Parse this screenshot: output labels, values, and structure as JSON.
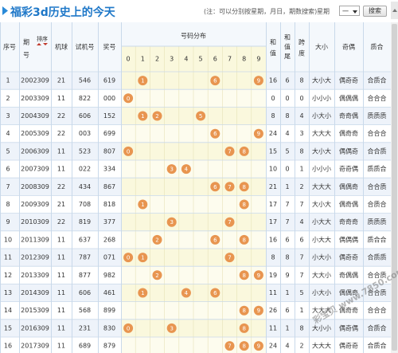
{
  "header": {
    "title": "福彩3d历史上的今天",
    "note": "(注：可以分别按星期，月日，期数搜索)",
    "week_label": "星期",
    "week_select": "一",
    "search_label": "搜索"
  },
  "columns": {
    "seq": "序号",
    "period": "期号",
    "sort": "排序",
    "machine": "机球",
    "test": "试机号",
    "prize": "奖号",
    "dist": "号码分布",
    "sum": "和值",
    "sumtail": "和值尾",
    "span": "跨度",
    "size": "大小",
    "oddeven": "奇偶",
    "prime": "质合",
    "digits": [
      "0",
      "1",
      "2",
      "3",
      "4",
      "5",
      "6",
      "7",
      "8",
      "9"
    ]
  },
  "colors": {
    "ball": "#e89550",
    "ball_text": "#ffffff",
    "odd_row": "#eef3fa",
    "even_row": "#ffffff",
    "dist_odd": "#faf8dd",
    "dist_even": "#fdfcee",
    "border": "#c9d9ea",
    "title": "#1f78c8"
  },
  "watermark": "彩宝贝 www.7850.com",
  "chart_data": {
    "type": "table",
    "rows": [
      {
        "seq": "1",
        "period": "2002309",
        "machine": "21",
        "test": "546",
        "prize": "619",
        "balls": [
          1,
          6,
          9
        ],
        "sum": "16",
        "tail": "6",
        "span": "8",
        "size": "大小大",
        "oe": "偶奇奇",
        "pc": "合质合"
      },
      {
        "seq": "2",
        "period": "2003309",
        "machine": "11",
        "test": "822",
        "prize": "000",
        "balls": [
          0
        ],
        "sum": "0",
        "tail": "0",
        "span": "0",
        "size": "小小小",
        "oe": "偶偶偶",
        "pc": "合合合"
      },
      {
        "seq": "3",
        "period": "2004309",
        "machine": "22",
        "test": "606",
        "prize": "152",
        "balls": [
          1,
          2,
          5
        ],
        "sum": "8",
        "tail": "8",
        "span": "4",
        "size": "小大小",
        "oe": "奇奇偶",
        "pc": "质质质"
      },
      {
        "seq": "4",
        "period": "2005309",
        "machine": "22",
        "test": "003",
        "prize": "699",
        "balls": [
          6,
          9
        ],
        "sum": "24",
        "tail": "4",
        "span": "3",
        "size": "大大大",
        "oe": "偶奇奇",
        "pc": "合合合"
      },
      {
        "seq": "5",
        "period": "2006309",
        "machine": "11",
        "test": "523",
        "prize": "807",
        "balls": [
          0,
          7,
          8
        ],
        "sum": "15",
        "sum_alt": "",
        "tail": "5",
        "span": "8",
        "size": "大小大",
        "oe": "偶偶奇",
        "pc": "合合质"
      },
      {
        "seq": "6",
        "period": "2007309",
        "machine": "11",
        "test": "022",
        "prize": "334",
        "balls": [
          3,
          4
        ],
        "sum": "10",
        "tail": "0",
        "span": "1",
        "size": "小小小",
        "oe": "奇奇偶",
        "pc": "质质合"
      },
      {
        "seq": "7",
        "period": "2008309",
        "machine": "22",
        "test": "434",
        "prize": "867",
        "balls": [
          6,
          7,
          8
        ],
        "sum": "21",
        "tail": "1",
        "span": "2",
        "size": "大大大",
        "oe": "偶偶奇",
        "pc": "合合质"
      },
      {
        "seq": "8",
        "period": "2009309",
        "machine": "21",
        "test": "708",
        "prize": "818",
        "balls": [
          1,
          8
        ],
        "sum": "17",
        "tail": "7",
        "span": "7",
        "size": "大小大",
        "oe": "偶奇偶",
        "pc": "合质合"
      },
      {
        "seq": "9",
        "period": "2010309",
        "machine": "22",
        "test": "819",
        "prize": "377",
        "balls": [
          3,
          7
        ],
        "sum": "17",
        "tail": "7",
        "span": "4",
        "size": "小大大",
        "oe": "奇奇奇",
        "pc": "质质质"
      },
      {
        "seq": "10",
        "period": "2011309",
        "machine": "11",
        "test": "637",
        "prize": "268",
        "balls": [
          2,
          6,
          8
        ],
        "sum": "16",
        "tail": "6",
        "span": "6",
        "size": "小大大",
        "oe": "偶偶偶",
        "pc": "质合合"
      },
      {
        "seq": "11",
        "period": "2012309",
        "machine": "11",
        "test": "787",
        "prize": "071",
        "balls": [
          0,
          1,
          7
        ],
        "sum": "8",
        "tail": "8",
        "span": "7",
        "size": "小大小",
        "oe": "偶奇奇",
        "pc": "合质质"
      },
      {
        "seq": "12",
        "period": "2013309",
        "machine": "11",
        "test": "877",
        "prize": "982",
        "balls": [
          2,
          8,
          9
        ],
        "sum": "19",
        "tail": "9",
        "span": "7",
        "size": "大大小",
        "oe": "奇偶偶",
        "pc": "合合质"
      },
      {
        "seq": "13",
        "period": "2014309",
        "machine": "11",
        "test": "606",
        "prize": "461",
        "balls": [
          1,
          4,
          6
        ],
        "sum": "11",
        "tail": "1",
        "span": "5",
        "size": "小大小",
        "oe": "偶偶奇",
        "pc": "合合质"
      },
      {
        "seq": "14",
        "period": "2015309",
        "machine": "11",
        "test": "568",
        "prize": "899",
        "balls": [
          8,
          9
        ],
        "sum": "26",
        "tail": "6",
        "span": "1",
        "size": "大大大",
        "oe": "偶奇奇",
        "pc": "合合合"
      },
      {
        "seq": "15",
        "period": "2016309",
        "machine": "11",
        "test": "231",
        "prize": "830",
        "balls": [
          0,
          3,
          8
        ],
        "sum": "11",
        "tail": "1",
        "span": "8",
        "size": "大小小",
        "oe": "偶奇偶",
        "pc": "合质合"
      },
      {
        "seq": "16",
        "period": "2017309",
        "machine": "11",
        "test": "689",
        "prize": "879",
        "balls": [
          7,
          8,
          9
        ],
        "sum": "24",
        "tail": "4",
        "span": "2",
        "size": "大大大",
        "oe": "偶奇奇",
        "pc": "合质合"
      }
    ]
  }
}
